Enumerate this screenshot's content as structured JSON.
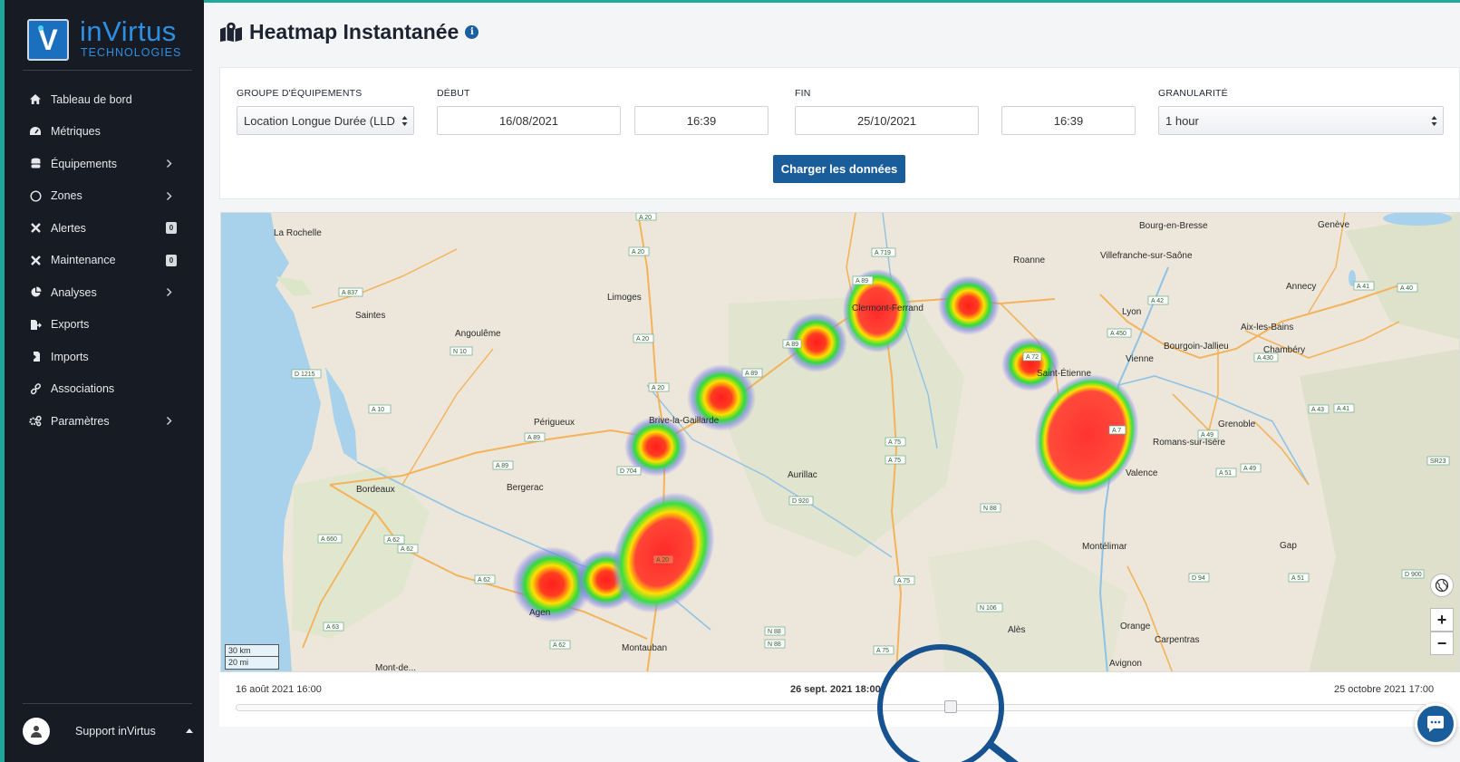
{
  "brand": {
    "name": "inVirtus",
    "sub": "TECHNOLOGIES",
    "letter": "V"
  },
  "sidebar": {
    "items": [
      {
        "label": "Tableau de bord",
        "icon": "home-icon"
      },
      {
        "label": "Métriques",
        "icon": "gauge-icon"
      },
      {
        "label": "Équipements",
        "icon": "database-icon",
        "chevron": true
      },
      {
        "label": "Zones",
        "icon": "circle-icon",
        "chevron": true
      },
      {
        "label": "Alertes",
        "icon": "tools-icon",
        "badge": "0"
      },
      {
        "label": "Maintenance",
        "icon": "wrench-icon",
        "badge": "0"
      },
      {
        "label": "Analyses",
        "icon": "pie-chart-icon",
        "chevron": true
      },
      {
        "label": "Exports",
        "icon": "file-export-icon"
      },
      {
        "label": "Imports",
        "icon": "file-import-icon"
      },
      {
        "label": "Associations",
        "icon": "link-icon"
      },
      {
        "label": "Paramètres",
        "icon": "cogs-icon",
        "chevron": true
      }
    ],
    "user": "Support inVirtus"
  },
  "page": {
    "title": "Heatmap Instantanée"
  },
  "filters": {
    "group_label": "GROUPE D'ÉQUIPEMENTS",
    "group_value": "Location Longue Durée (LLD",
    "start_label": "DÉBUT",
    "start_date": "16/08/2021",
    "start_time": "16:39",
    "end_label": "FIN",
    "end_date": "25/10/2021",
    "end_time": "16:39",
    "granularity_label": "GRANULARITÉ",
    "granularity_value": "1 hour",
    "load_button": "Charger les données"
  },
  "map": {
    "scale_km": "30 km",
    "scale_mi": "20 mi",
    "zoom_in": "+",
    "zoom_out": "−",
    "towns": {
      "la_rochelle": "La Rochelle",
      "saintes": "Saintes",
      "angouleme": "Angoulême",
      "limoges": "Limoges",
      "perigueux": "Périgueux",
      "brive": "Brive-la-Gaillarde",
      "bordeaux": "Bordeaux",
      "bergerac": "Bergerac",
      "agen": "Agen",
      "montauban": "Montauban",
      "clermont": "Clermont-Ferrand",
      "aurillac": "Aurillac",
      "roanne": "Roanne",
      "villefranche": "Villefranche-sur-Saône",
      "lyon": "Lyon",
      "vienne": "Vienne",
      "saint_etienne": "Saint-Étienne",
      "bourgoin": "Bourgoin-Jallieu",
      "chambery": "Chambéry",
      "annecy": "Annecy",
      "aix": "Aix-les-Bains",
      "geneve": "Genève",
      "bourg": "Bourg-en-Bresse",
      "grenoble": "Grenoble",
      "romans": "Romans-sur-Isère",
      "valence": "Valence",
      "montelimar": "Montélimar",
      "orange": "Orange",
      "carpentras": "Carpentras",
      "avignon": "Avignon",
      "gap": "Gap",
      "ales": "Alès",
      "montdemarsan": "Mont-de..."
    },
    "roads": [
      "A 20",
      "A 20",
      "A 719",
      "A 89",
      "A 837",
      "N 10",
      "D 1215",
      "A 10",
      "A 89",
      "A 89",
      "A 20",
      "A 20",
      "A 89",
      "D 704",
      "A 89",
      "D 920",
      "A 75",
      "A 75",
      "N 88",
      "A 72",
      "A 7",
      "A 42",
      "A 450",
      "A 49",
      "A 43",
      "A 41",
      "A 430",
      "A 40",
      "A 51",
      "A 62",
      "A 660",
      "A 62",
      "A 62",
      "A 63",
      "A 62",
      "A 20",
      "N 88",
      "N 88",
      "A 75",
      "N 106",
      "A 75",
      "A 51",
      "D 94",
      "D 900",
      "SR23",
      "A 41",
      "A 49"
    ]
  },
  "timeline": {
    "start": "16 août 2021 16:00",
    "current": "26 sept. 2021 18:00",
    "end": "25 octobre 2021 17:00",
    "position": 0.6
  },
  "colors": {
    "sidebar_bg": "#171b24",
    "accent": "#1fa99a",
    "brand": "#2d8fe3",
    "button": "#1a5d9b",
    "heat_high": "#ff2a2a",
    "heat_mid": "#ffe600",
    "heat_low": "#22dd44"
  }
}
